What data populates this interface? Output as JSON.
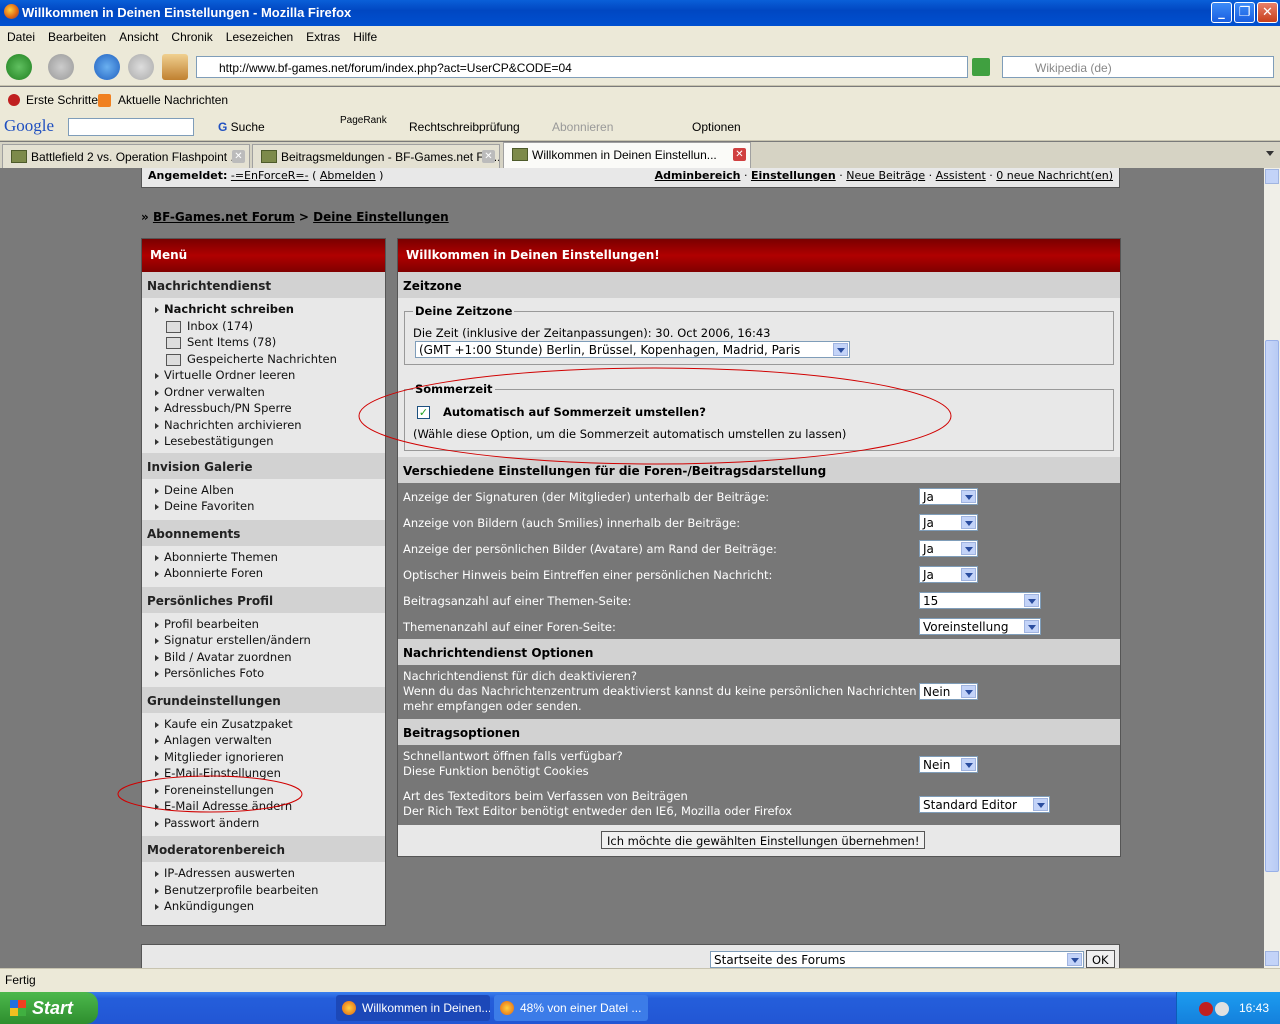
{
  "window": {
    "title": "Willkommen in Deinen Einstellungen - Mozilla Firefox"
  },
  "menubar": [
    "Datei",
    "Bearbeiten",
    "Ansicht",
    "Chronik",
    "Lesezeichen",
    "Extras",
    "Hilfe"
  ],
  "nav": {
    "url": "http://www.bf-games.net/forum/index.php?act=UserCP&CODE=04",
    "search_placeholder": "Wikipedia (de)"
  },
  "bookmarks": [
    "Erste Schritte",
    "Aktuelle Nachrichten"
  ],
  "googlebar": {
    "logo": "Google",
    "search": "Suche",
    "pagerank": "PageRank",
    "spell": "Rechtschreibprüfung",
    "subscribe": "Abonnieren",
    "options": "Optionen"
  },
  "tabs": [
    "Battlefield 2 vs. Operation Flashpoint ...",
    "Beitragsmeldungen - BF-Games.net Fo...",
    "Willkommen in Deinen Einstellun..."
  ],
  "topstrip": {
    "logged": "Angemeldet:",
    "user": "-=EnForceR=-",
    "logout": "Abmelden",
    "links": [
      "Adminbereich",
      "Einstellungen",
      "Neue Beiträge",
      "Assistent",
      "0 neue Nachricht(en)"
    ]
  },
  "breadcrumb": {
    "root": "BF-Games.net Forum",
    "sep": ">",
    "current": "Deine Einstellungen"
  },
  "menu": {
    "title": "Menü",
    "sections": [
      {
        "head": "Nachrichtendienst",
        "items": [
          "Nachricht schreiben",
          "Inbox (174)",
          "Sent Items (78)",
          "Gespeicherte Nachrichten",
          "Virtuelle Ordner leeren",
          "Ordner verwalten",
          "Adressbuch/PN Sperre",
          "Nachrichten archivieren",
          "Lesebestätigungen"
        ]
      },
      {
        "head": "Invision Galerie",
        "items": [
          "Deine Alben",
          "Deine Favoriten"
        ]
      },
      {
        "head": "Abonnements",
        "items": [
          "Abonnierte Themen",
          "Abonnierte Foren"
        ]
      },
      {
        "head": "Persönliches Profil",
        "items": [
          "Profil bearbeiten",
          "Signatur erstellen/ändern",
          "Bild / Avatar zuordnen",
          "Persönliches Foto"
        ]
      },
      {
        "head": "Grundeinstellungen",
        "items": [
          "Kaufe ein Zusatzpaket",
          "Anlagen verwalten",
          "Mitglieder ignorieren",
          "E-Mail-Einstellungen",
          "Foreneinstellungen",
          "E-Mail Adresse ändern",
          "Passwort ändern"
        ]
      },
      {
        "head": "Moderatorenbereich",
        "items": [
          "IP-Adressen auswerten",
          "Benutzerprofile bearbeiten",
          "Ankündigungen"
        ]
      }
    ]
  },
  "panel": {
    "title": "Willkommen in Deinen Einstellungen!",
    "zeitzone_head": "Zeitzone",
    "zone_legend": "Deine Zeitzone",
    "zone_time": "Die Zeit (inklusive der Zeitanpassungen): 30. Oct 2006, 16:43",
    "zone_select": "(GMT +1:00 Stunde) Berlin, Brüssel, Kopenhagen, Madrid, Paris",
    "dst_legend": "Sommerzeit",
    "dst_label": "Automatisch auf Sommerzeit umstellen?",
    "dst_hint": "(Wähle diese Option, um die Sommerzeit automatisch umstellen zu lassen)",
    "display_head": "Verschiedene Einstellungen für die Foren-/Beitragsdarstellung",
    "rows": [
      {
        "label": "Anzeige der Signaturen (der Mitglieder) unterhalb der Beiträge:",
        "value": "Ja"
      },
      {
        "label": "Anzeige von Bildern (auch Smilies) innerhalb der Beiträge:",
        "value": "Ja"
      },
      {
        "label": "Anzeige der persönlichen Bilder (Avatare) am Rand der Beiträge:",
        "value": "Ja"
      },
      {
        "label": "Optischer Hinweis beim Eintreffen einer persönlichen Nachricht:",
        "value": "Ja"
      },
      {
        "label": "Beitragsanzahl auf einer Themen-Seite:",
        "value": "15"
      },
      {
        "label": "Themenanzahl auf einer Foren-Seite:",
        "value": "Voreinstellung"
      }
    ],
    "pm_head": "Nachrichtendienst Optionen",
    "pm_label1": "Nachrichtendienst für dich deaktivieren?",
    "pm_label2": "Wenn du das Nachrichtenzentrum deaktivierst kannst du keine persönlichen Nachrichten",
    "pm_label3": "mehr empfangen oder senden.",
    "pm_value": "Nein",
    "post_head": "Beitragsoptionen",
    "quick_label1": "Schnellantwort öffnen falls verfügbar?",
    "quick_label2": "Diese Funktion benötigt Cookies",
    "quick_value": "Nein",
    "editor_label1": "Art des Texteditors beim Verfassen von Beiträgen",
    "editor_label2": "Der Rich Text Editor benötigt entweder den IE6, Mozilla oder Firefox",
    "editor_value": "Standard Editor",
    "submit": "Ich möchte die gewählten Einstellungen übernehmen!"
  },
  "footer": {
    "jump": "Startseite des Forums",
    "ok": "OK"
  },
  "status": "Fertig",
  "taskbar": {
    "start": "Start",
    "items": [
      "Willkommen in Deinen...",
      "48% von einer Datei ..."
    ],
    "clock": "16:43"
  }
}
